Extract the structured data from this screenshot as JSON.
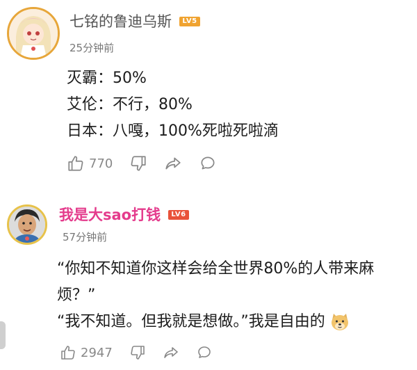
{
  "comments": [
    {
      "username": "七铭的鲁迪乌斯",
      "level": "LV5",
      "time": "25分钟前",
      "lines": [
        "灭霸：50%",
        "艾伦：不行，80%",
        "日本：八嘎，100%死啦死啦滴"
      ],
      "likes": "770"
    },
    {
      "username": "我是大sao打钱",
      "level": "LV6",
      "time": "57分钟前",
      "lines": [
        "“你知不知道你这样会给全世界80%的人带来麻",
        "烦？”",
        "“我不知道。但我就是想做。”我是自由的"
      ],
      "likes": "2947"
    }
  ],
  "icons": {
    "like": "thumbs-up-icon",
    "dislike": "thumbs-down-icon",
    "share": "share-icon",
    "reply": "comment-bubble-icon",
    "emoji": "doge-emoji-icon"
  },
  "colors": {
    "level5": "#f0a330",
    "level6": "#e9523a",
    "vip_name": "#e43b8c"
  }
}
